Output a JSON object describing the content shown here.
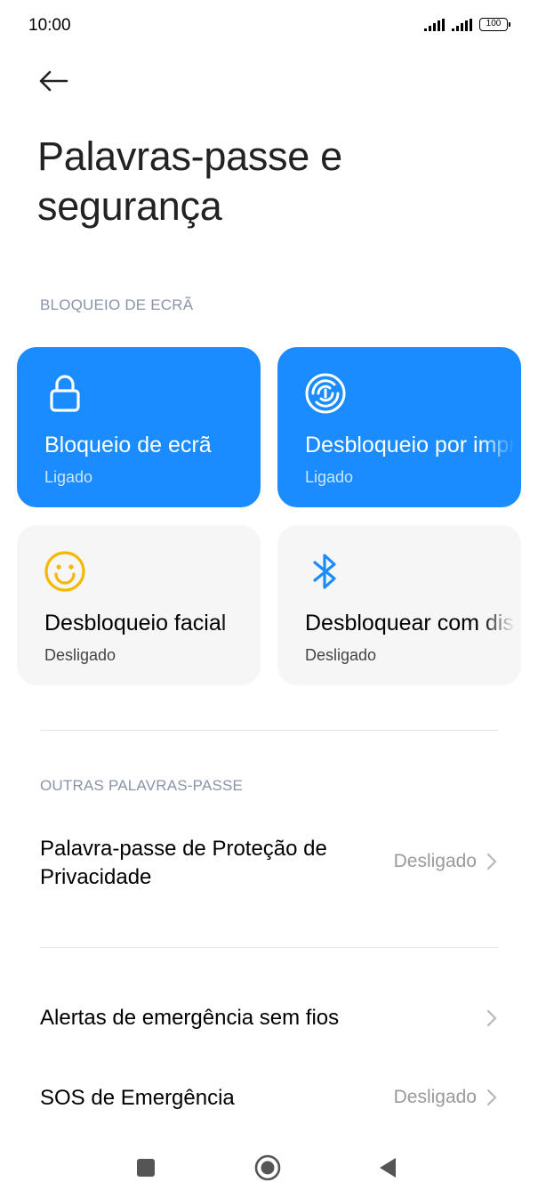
{
  "status_bar": {
    "time": "10:00",
    "battery": "100"
  },
  "page": {
    "title": "Palavras-passe e segurança"
  },
  "lock_section": {
    "label": "BLOQUEIO DE ECRÃ",
    "tiles": [
      {
        "title": "Bloqueio de ecrã",
        "status": "Ligado",
        "icon": "lock-icon",
        "state": "on"
      },
      {
        "title": "Desbloqueio por impressão digital",
        "status": "Ligado",
        "icon": "fingerprint-icon",
        "state": "on"
      },
      {
        "title": "Desbloqueio facial",
        "status": "Desligado",
        "icon": "smiley-face-icon",
        "state": "off"
      },
      {
        "title": "Desbloquear com dispositivo Bluetooth",
        "status": "Desligado",
        "icon": "bluetooth-icon",
        "state": "off"
      }
    ]
  },
  "other_section": {
    "label": "OUTRAS PALAVRAS-PASSE",
    "privacy_password": {
      "title": "Palavra-passe de Proteção de Privacidade",
      "value": "Desligado"
    }
  },
  "emergency_alerts": {
    "title": "Alertas de emergência sem fios"
  },
  "emergency_sos": {
    "title": "SOS de Emergência",
    "value": "Desligado"
  },
  "colors": {
    "accent": "#1a8cff",
    "tile_off_bg": "#f6f6f6",
    "secondary_text": "#9a9a9a",
    "section_label": "#8a93a8",
    "face_icon": "#f5b800"
  }
}
